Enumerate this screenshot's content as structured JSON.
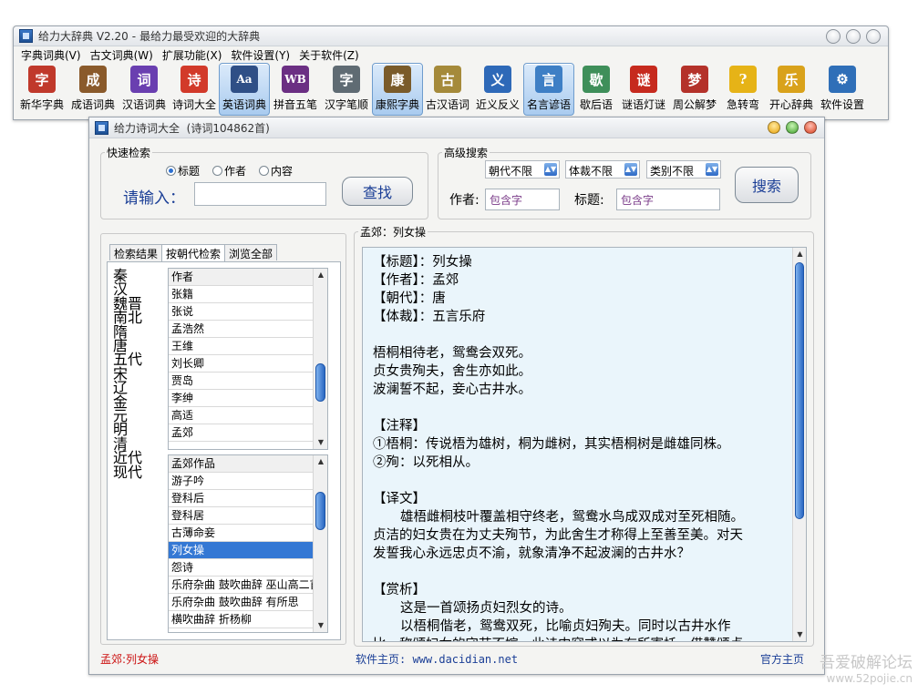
{
  "main_window": {
    "title": "给力大辞典 V2.20",
    "subtitle": "最给力最受欢迎的大辞典",
    "menu": [
      "字典词典(V)",
      "古文词典(W)",
      "扩展功能(X)",
      "软件设置(Y)",
      "关于软件(Z)"
    ],
    "toolbar": [
      {
        "label": "新华字典",
        "icon": "character-icon",
        "glyph": "字",
        "color": "#c0392b",
        "width": 56,
        "active": false
      },
      {
        "label": "成语词典",
        "icon": "book-icon",
        "glyph": "成",
        "color": "#8a5a2b",
        "width": 56,
        "active": false
      },
      {
        "label": "汉语词典",
        "icon": "dictionary-icon",
        "glyph": "词",
        "color": "#6a3fb0",
        "width": 56,
        "active": false
      },
      {
        "label": "诗词大全",
        "icon": "poem-icon",
        "glyph": "诗",
        "color": "#d23a2a",
        "width": 54,
        "active": false
      },
      {
        "label": "英语词典",
        "icon": "english-icon",
        "glyph": "Aa",
        "color": "#2f4f86",
        "width": 56,
        "active": true
      },
      {
        "label": "拼音五笔",
        "icon": "pinyin-icon",
        "glyph": "WB",
        "color": "#6b2f83",
        "width": 56,
        "active": false
      },
      {
        "label": "汉字笔顺",
        "icon": "stroke-icon",
        "glyph": "字",
        "color": "#5f6b73",
        "width": 56,
        "active": false
      },
      {
        "label": "康熙字典",
        "icon": "kangxi-icon",
        "glyph": "康",
        "color": "#7a5b2a",
        "width": 56,
        "active": true
      },
      {
        "label": "古汉语词",
        "icon": "ancient-icon",
        "glyph": "古",
        "color": "#a58a3a",
        "width": 54,
        "active": false
      },
      {
        "label": "近义反义",
        "icon": "synonym-icon",
        "glyph": "义",
        "color": "#2e69b8",
        "width": 56,
        "active": false
      },
      {
        "label": "名言谚语",
        "icon": "quote-icon",
        "glyph": "言",
        "color": "#3e7fc5",
        "width": 56,
        "active": true
      },
      {
        "label": "歇后语",
        "icon": "xiehouyu-icon",
        "glyph": "歇",
        "color": "#3f8f5a",
        "width": 48,
        "active": false
      },
      {
        "label": "谜语灯谜",
        "icon": "lantern-icon",
        "glyph": "谜",
        "color": "#c62a1e",
        "width": 56,
        "active": false
      },
      {
        "label": "周公解梦",
        "icon": "dream-icon",
        "glyph": "梦",
        "color": "#b4322a",
        "width": 56,
        "active": false
      },
      {
        "label": "急转弯",
        "icon": "lightbulb-icon",
        "glyph": "?",
        "color": "#e6b317",
        "width": 50,
        "active": false
      },
      {
        "label": "开心辞典",
        "icon": "happy-icon",
        "glyph": "乐",
        "color": "#d9a21b",
        "width": 56,
        "active": false
      },
      {
        "label": "软件设置",
        "icon": "gear-icon",
        "glyph": "⚙",
        "color": "#2f6fb8",
        "width": 56,
        "active": false
      }
    ]
  },
  "poem_window": {
    "title": "给力诗词大全",
    "count": "(诗词104862首)",
    "quick_search": {
      "legend": "快速检索",
      "options": [
        "标题",
        "作者",
        "内容"
      ],
      "selected_option": "标题",
      "prompt": "请输入：",
      "input_value": "",
      "button": "查找"
    },
    "advanced_search": {
      "legend": "高级搜索",
      "dynasty": "朝代不限",
      "genre": "体裁不限",
      "category": "类别不限",
      "author_label": "作者:",
      "author_value": "包含字",
      "title_label": "标题:",
      "title_value": "包含字",
      "button": "搜索"
    },
    "tabs": [
      "检索结果",
      "按朝代检索",
      "浏览全部"
    ],
    "active_tab": "按朝代检索",
    "dynasties": [
      "秦",
      "汉",
      "魏晋",
      "南北",
      "隋",
      "唐",
      "五代",
      "宋",
      "辽",
      "金",
      "元",
      "明",
      "清",
      "近代",
      "现代"
    ],
    "authors": {
      "header": "作者",
      "items": [
        "张籍",
        "张说",
        "孟浩然",
        "王维",
        "刘长卿",
        "贾岛",
        "李绅",
        "高适",
        "孟郊"
      ]
    },
    "works": {
      "header": "孟郊作品",
      "items": [
        "游子吟",
        "登科后",
        "登科居",
        "古薄命妾",
        "列女操",
        "怨诗",
        "乐府杂曲 鼓吹曲辞 巫山高二首",
        "乐府杂曲 鼓吹曲辞 有所思",
        "横吹曲辞 折杨柳"
      ],
      "selected": "列女操"
    },
    "content": {
      "legend": "孟郊：列女操",
      "lines": [
        {
          "text": "【标题】：列女操",
          "indent": false
        },
        {
          "text": "【作者】：孟郊",
          "indent": false
        },
        {
          "text": "【朝代】：唐",
          "indent": false
        },
        {
          "text": "【体裁】：五言乐府",
          "indent": false
        },
        {
          "text": "",
          "indent": false
        },
        {
          "text": "梧桐相待老，鸳鸯会双死。",
          "indent": false
        },
        {
          "text": "贞女贵殉夫，舍生亦如此。",
          "indent": false
        },
        {
          "text": "波澜誓不起，妾心古井水。",
          "indent": false
        },
        {
          "text": "",
          "indent": false
        },
        {
          "text": "【注释】",
          "indent": false
        },
        {
          "text": "①梧桐：传说梧为雄树，桐为雌树，其实梧桐树是雌雄同株。",
          "indent": false
        },
        {
          "text": "②殉：以死相从。",
          "indent": false
        },
        {
          "text": "",
          "indent": false
        },
        {
          "text": "【译文】",
          "indent": false
        },
        {
          "text": "雄梧雌桐枝叶覆盖相守终老，鸳鸯水鸟成双成对至死相随。",
          "indent": true
        },
        {
          "text": "贞洁的妇女贵在为丈夫殉节，为此舍生才称得上至善至美。对天",
          "indent": false
        },
        {
          "text": "发誓我心永远忠贞不渝，就象清净不起波澜的古井水？",
          "indent": false
        },
        {
          "text": "",
          "indent": false
        },
        {
          "text": "【赏析】",
          "indent": false
        },
        {
          "text": "这是一首颂扬贞妇烈女的诗。",
          "indent": true
        },
        {
          "text": "以梧桐偕老，鸳鸯双死，比喻贞妇殉夫。同时以古井水作",
          "indent": true
        },
        {
          "text": "比，称颂妇女的守节不嫁。此诗内容或以为有所寄托，借赞颂贞",
          "indent": false
        }
      ]
    },
    "status": {
      "left": "孟郊:列女操",
      "homepage": "软件主页: www.dacidian.net",
      "right": "官方主页"
    }
  },
  "watermark": {
    "line1": "吾爱破解论坛",
    "line2": "www.52pojie.cn"
  }
}
